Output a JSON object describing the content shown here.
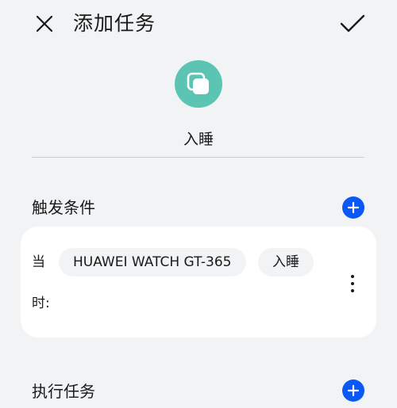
{
  "header": {
    "title": "添加任务",
    "close_icon": "close-icon",
    "confirm_icon": "check-icon"
  },
  "task": {
    "icon": "copy-icon",
    "icon_color": "#5bc4b2",
    "name": "入睡"
  },
  "trigger": {
    "section_title": "触发条件",
    "add_icon": "plus-icon",
    "condition": {
      "label_when_first": "当",
      "label_when_second": "时:",
      "device": "HUAWEI WATCH GT-365",
      "event": "入睡",
      "more_icon": "more-vertical-icon"
    }
  },
  "action": {
    "section_title": "执行任务",
    "add_icon": "plus-icon"
  },
  "colors": {
    "accent": "#0a59f7",
    "background": "#f1f3f5",
    "card": "#ffffff"
  }
}
